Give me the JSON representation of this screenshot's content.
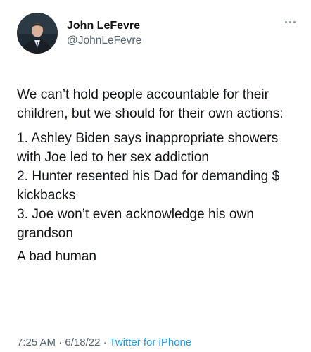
{
  "author": {
    "display_name": "John LeFevre",
    "handle": "@JohnLeFevre",
    "avatar_icon": "user-avatar"
  },
  "menu_icon": "more-horizontal-icon",
  "tweet": {
    "intro": "We can’t hold people accountable for their children, but we should for their own actions:",
    "points": [
      "1. Ashley Biden says inappropriate showers with Joe led to her sex addiction",
      "2. Hunter resented his Dad for demanding $ kickbacks",
      "3. Joe won’t even acknowledge his own grandson"
    ],
    "closing": "A bad human"
  },
  "meta": {
    "time": "7:25 AM",
    "separator": "·",
    "date": "6/18/22",
    "source": "Twitter for iPhone"
  },
  "colors": {
    "text": "#0f1419",
    "secondary": "#536471",
    "link": "#1d9bf0"
  }
}
